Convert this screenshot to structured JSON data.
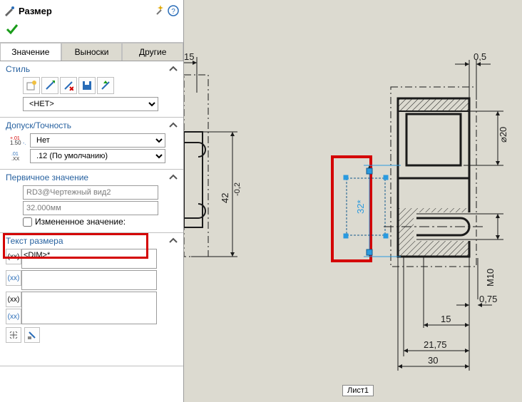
{
  "panel": {
    "title": "Размер",
    "tabs": {
      "value": "Значение",
      "leaders": "Выноски",
      "other": "Другие"
    },
    "style": {
      "label": "Стиль",
      "dropdown": "<НЕТ>"
    },
    "tolerance": {
      "label": "Допуск/Точность",
      "type": "Нет",
      "precision": ".12 (По умолчанию)"
    },
    "primary": {
      "label": "Первичное значение",
      "name": "RD3@Чертежный вид2",
      "value": "32.000мм",
      "override_cb": "Измененное значение:"
    },
    "dimtext": {
      "label": "Текст размера",
      "value": "<DIM>*"
    }
  },
  "drawing": {
    "sheet_label": "Лист1",
    "dims": {
      "d15a": "15",
      "d0_5": "0,5",
      "d42": "42",
      "d42tol": "-0,2",
      "d32": "32*",
      "dia20": "⌀20",
      "m10": "M10",
      "d0_75": "0,75",
      "d15b": "15",
      "d21_75": "21,75",
      "d30": "30"
    }
  }
}
